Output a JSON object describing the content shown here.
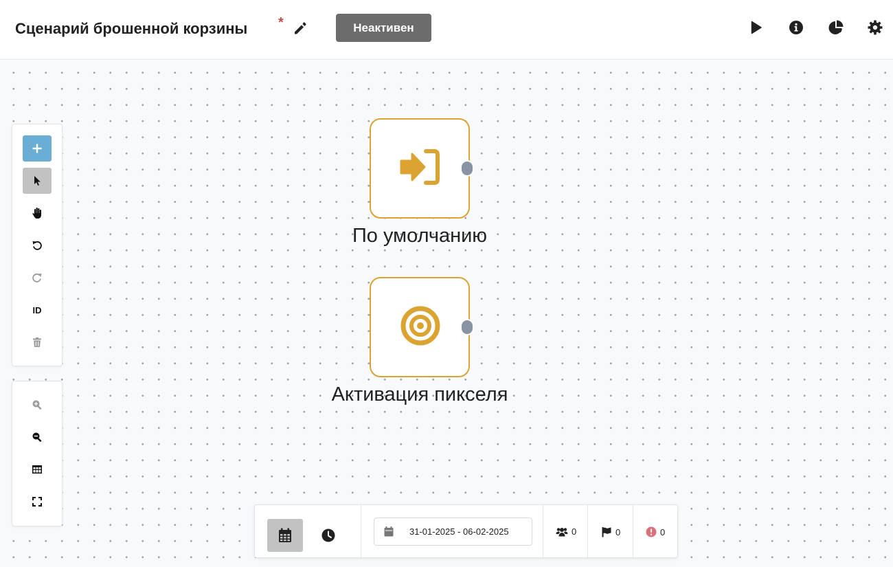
{
  "header": {
    "title": "Сценарий брошенной корзины",
    "unsaved_marker": "*",
    "status": "Неактивен",
    "icons": [
      "pencil-icon",
      "play-icon",
      "info-icon",
      "pie-chart-icon",
      "gear-icon"
    ]
  },
  "toolbar": {
    "tools": [
      "plus-icon",
      "cursor-icon",
      "hand-icon",
      "undo-icon",
      "redo-icon",
      "id-label",
      "trash-icon"
    ],
    "id_label": "ID",
    "zoom_tools": [
      "zoom-in-icon",
      "zoom-out-icon",
      "grid-icon",
      "fullscreen-icon"
    ]
  },
  "nodes": [
    {
      "label": "По умолчанию",
      "icon": "sign-in-icon"
    },
    {
      "label": "Активация пикселя",
      "icon": "target-icon"
    }
  ],
  "bottombar": {
    "date_range": "31-01-2025 - 06-02-2025",
    "users_count": "0",
    "goals_count": "0",
    "errors_count": "0"
  },
  "colors": {
    "node_border": "#dba332",
    "node_icon": "#dba332",
    "status_badge": "#6c6c6c",
    "add_button": "#6aaed6",
    "port": "#8a93a3",
    "error": "#d9727a"
  }
}
